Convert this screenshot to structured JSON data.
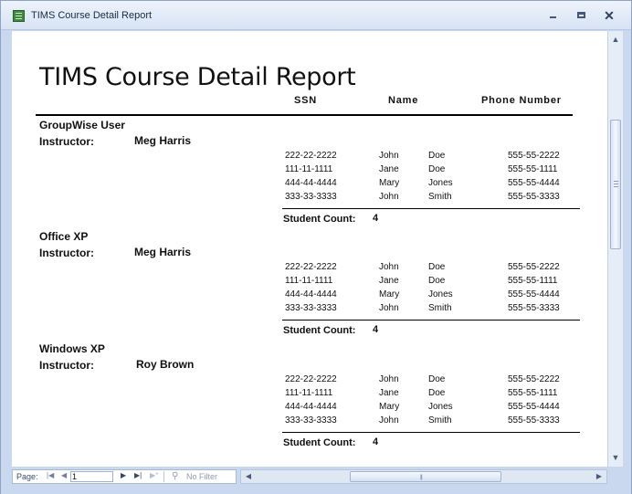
{
  "window": {
    "title": "TIMS Course Detail Report"
  },
  "report": {
    "title": "TIMS Course Detail Report",
    "columns": {
      "ssn": "SSN",
      "name": "Name",
      "phone": "Phone Number"
    },
    "instructor_label": "Instructor:",
    "count_label": "Student Count:",
    "groups": [
      {
        "course": "GroupWise User",
        "instructor": "Meg Harris",
        "students": [
          {
            "ssn": "222-22-2222",
            "first": "John",
            "last": "Doe",
            "phone": "555-55-2222"
          },
          {
            "ssn": "111-11-1111",
            "first": "Jane",
            "last": "Doe",
            "phone": "555-55-1111"
          },
          {
            "ssn": "444-44-4444",
            "first": "Mary",
            "last": "Jones",
            "phone": "555-55-4444"
          },
          {
            "ssn": "333-33-3333",
            "first": "John",
            "last": "Smith",
            "phone": "555-55-3333"
          }
        ],
        "count": "4"
      },
      {
        "course": "Office XP",
        "instructor": "Meg Harris",
        "students": [
          {
            "ssn": "222-22-2222",
            "first": "John",
            "last": "Doe",
            "phone": "555-55-2222"
          },
          {
            "ssn": "111-11-1111",
            "first": "Jane",
            "last": "Doe",
            "phone": "555-55-1111"
          },
          {
            "ssn": "444-44-4444",
            "first": "Mary",
            "last": "Jones",
            "phone": "555-55-4444"
          },
          {
            "ssn": "333-33-3333",
            "first": "John",
            "last": "Smith",
            "phone": "555-55-3333"
          }
        ],
        "count": "4"
      },
      {
        "course": "Windows XP",
        "instructor": "Roy Brown",
        "students": [
          {
            "ssn": "222-22-2222",
            "first": "John",
            "last": "Doe",
            "phone": "555-55-2222"
          },
          {
            "ssn": "111-11-1111",
            "first": "Jane",
            "last": "Doe",
            "phone": "555-55-1111"
          },
          {
            "ssn": "444-44-4444",
            "first": "Mary",
            "last": "Jones",
            "phone": "555-55-4444"
          },
          {
            "ssn": "333-33-3333",
            "first": "John",
            "last": "Smith",
            "phone": "555-55-3333"
          }
        ],
        "count": "4"
      }
    ]
  },
  "navigation": {
    "page_label": "Page:",
    "page_value": "1",
    "filter_label": "No Filter",
    "icons": [
      "first-page-icon",
      "previous-page-icon",
      "next-page-icon",
      "last-page-icon",
      "new-record-icon",
      "filter-icon"
    ]
  },
  "colors": {
    "chrome": "#c9d8ee",
    "page": "#ffffff",
    "text": "#111111"
  }
}
